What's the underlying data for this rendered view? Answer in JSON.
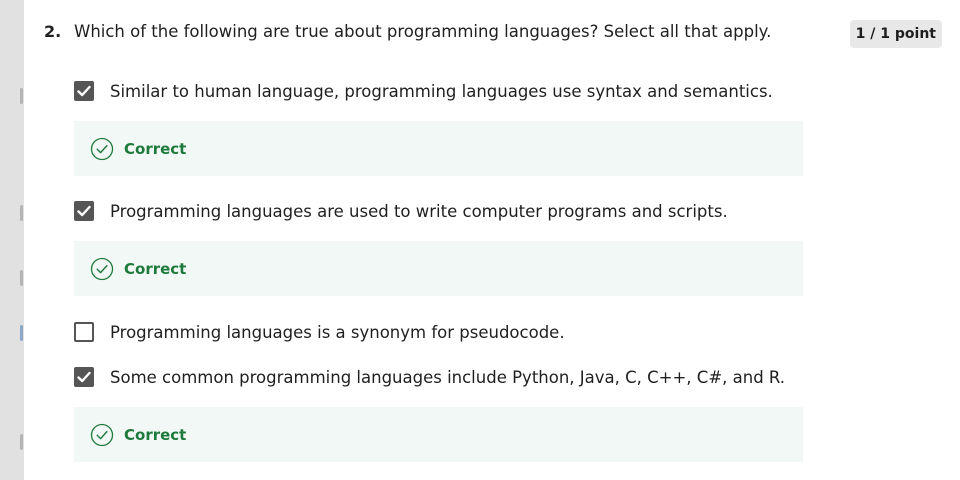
{
  "question": {
    "number": "2.",
    "text": "Which of the following are true about programming languages? Select all that apply.",
    "points": "1 / 1 point"
  },
  "options": [
    {
      "label": "Similar to human language, programming languages use syntax and semantics.",
      "checked": true,
      "feedback": "Correct"
    },
    {
      "label": "Programming languages are used to write computer programs and scripts.",
      "checked": true,
      "feedback": "Correct"
    },
    {
      "label": "Programming languages is a synonym for pseudocode.",
      "checked": false,
      "feedback": ""
    },
    {
      "label": "Some common programming languages include Python, Java, C, C++, C#, and R.",
      "checked": true,
      "feedback": "Correct"
    }
  ],
  "colors": {
    "checkbox": "#555555",
    "correct_text": "#1e7a3c",
    "feedback_bg": "#f2f8f5",
    "points_badge_bg": "#e8e8e8"
  },
  "icons": {
    "checked_box": "checkmark-icon",
    "feedback": "correct-check-circle-icon"
  }
}
